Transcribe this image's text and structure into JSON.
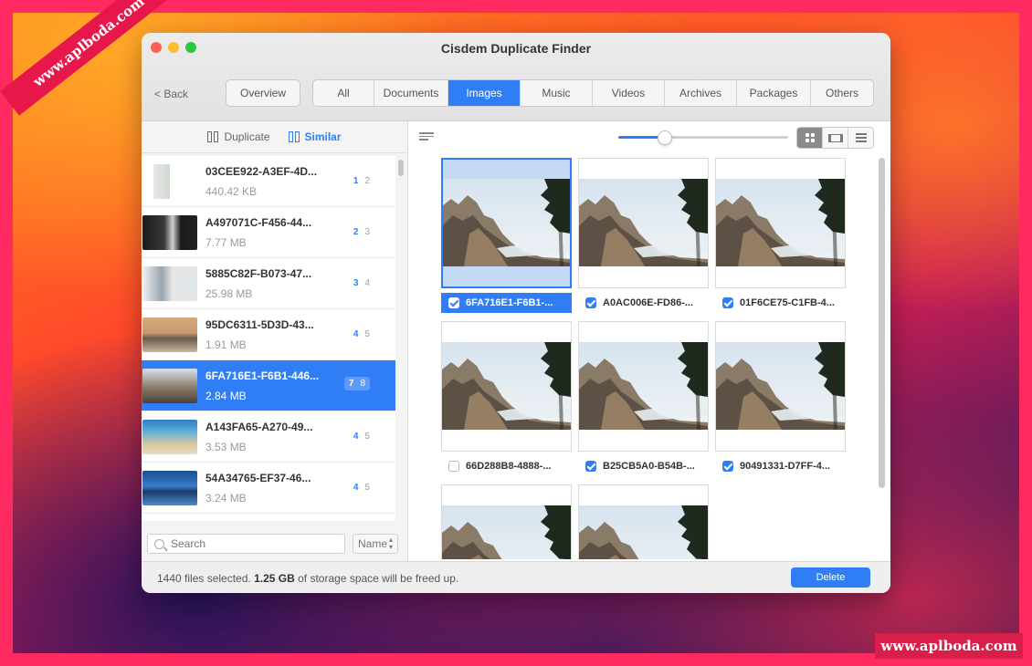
{
  "watermark": {
    "top_left": "www.aplboda.com",
    "bottom_right": "www.aplboda.com"
  },
  "window": {
    "title": "Cisdem Duplicate Finder"
  },
  "nav": {
    "back_label": "< Back",
    "overview_label": "Overview",
    "tabs": [
      {
        "label": "All",
        "width": 66
      },
      {
        "label": "Documents",
        "width": 80
      },
      {
        "label": "Images",
        "width": 78
      },
      {
        "label": "Music",
        "width": 78
      },
      {
        "label": "Videos",
        "width": 78
      },
      {
        "label": "Archives",
        "width": 78
      },
      {
        "label": "Packages",
        "width": 80
      },
      {
        "label": "Others",
        "width": 68
      }
    ],
    "active_tab": "Images"
  },
  "sidebar": {
    "modes": {
      "duplicate": "Duplicate",
      "similar": "Similar",
      "active": "Similar"
    },
    "groups": [
      {
        "name": "03CEE922-A3EF-4D...",
        "size": "440.42 KB",
        "count_a": "1",
        "count_b": "2",
        "selected": false
      },
      {
        "name": "A497071C-F456-44...",
        "size": "7.77 MB",
        "count_a": "2",
        "count_b": "3",
        "selected": false
      },
      {
        "name": "5885C82F-B073-47...",
        "size": "25.98 MB",
        "count_a": "3",
        "count_b": "4",
        "selected": false
      },
      {
        "name": "95DC6311-5D3D-43...",
        "size": "1.91 MB",
        "count_a": "4",
        "count_b": "5",
        "selected": false
      },
      {
        "name": "6FA716E1-F6B1-446...",
        "size": "2.84 MB",
        "count_a": "7",
        "count_b": "8",
        "selected": true
      },
      {
        "name": "A143FA65-A270-49...",
        "size": "3.53 MB",
        "count_a": "4",
        "count_b": "5",
        "selected": false
      },
      {
        "name": "54A34765-EF37-46...",
        "size": "3.24 MB",
        "count_a": "4",
        "count_b": "5",
        "selected": false
      }
    ],
    "search_placeholder": "Search",
    "sort_label": "Name"
  },
  "main": {
    "zoom_fraction": 0.27,
    "view_modes": [
      "thumbnails",
      "filmstrip",
      "list"
    ],
    "active_view": "thumbnails",
    "images": [
      {
        "name": "6FA716E1-F6B1-...",
        "checked": true,
        "selected": true
      },
      {
        "name": "A0AC006E-FD86-...",
        "checked": true,
        "selected": false
      },
      {
        "name": "01F6CE75-C1FB-4...",
        "checked": true,
        "selected": false
      },
      {
        "name": "66D288B8-4888-...",
        "checked": false,
        "selected": false
      },
      {
        "name": "B25CB5A0-B54B-...",
        "checked": true,
        "selected": false
      },
      {
        "name": "90491331-D7FF-4...",
        "checked": true,
        "selected": false
      },
      {
        "name": "",
        "checked": false,
        "selected": false
      },
      {
        "name": "",
        "checked": false,
        "selected": false
      }
    ]
  },
  "footer": {
    "files_count": "1440",
    "files_text": " files selected. ",
    "size": "1.25 GB",
    "size_text": " of storage space will be freed up.",
    "delete_label": "Delete"
  },
  "colors": {
    "accent": "#2f7ef5",
    "frame": "#ff2a5f"
  }
}
